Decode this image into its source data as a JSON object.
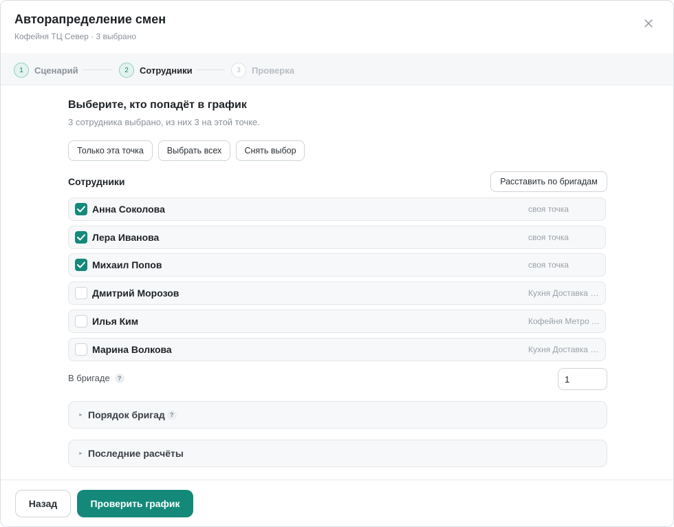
{
  "header": {
    "title": "Авторапределение смен",
    "subtitle": "Кофейня ТЦ Север · 3 выбрано",
    "close_icon": "close-icon"
  },
  "stepper": {
    "steps": [
      {
        "num": "1",
        "label": "Сценарий",
        "state": "done"
      },
      {
        "num": "2",
        "label": "Сотрудники",
        "state": "active"
      },
      {
        "num": "3",
        "label": "Проверка",
        "state": "todo"
      }
    ]
  },
  "selection": {
    "title": "Выберите, кто попадёт в график",
    "subtitle": "3 сотрудника выбрано, из них 3 на этой точке.",
    "only_this_point": "Только эта точка",
    "select_all": "Выбрать всех",
    "deselect": "Снять выбор"
  },
  "employees": {
    "label": "Сотрудники",
    "arrange_button": "Расставить по бригадам",
    "list": [
      {
        "name": "Анна Соколова",
        "location": "своя точка",
        "checked": true
      },
      {
        "name": "Лера Иванова",
        "location": "своя точка",
        "checked": true
      },
      {
        "name": "Михаил Попов",
        "location": "своя точка",
        "checked": true
      },
      {
        "name": "Дмитрий Морозов",
        "location": "Кухня Доставка Центр",
        "checked": false
      },
      {
        "name": "Илья Ким",
        "location": "Кофейня Метро Юг",
        "checked": false
      },
      {
        "name": "Марина Волкова",
        "location": "Кухня Доставка Центр",
        "checked": false
      }
    ]
  },
  "brigade": {
    "label": "В бригаде",
    "help": "?",
    "value": "1"
  },
  "accordions": {
    "order": {
      "title": "Порядок бригад",
      "help": "?"
    },
    "recent": {
      "title": "Последние расчёты"
    }
  },
  "footer": {
    "back": "Назад",
    "check": "Проверить график"
  },
  "colors": {
    "accent": "#14897a",
    "step_bg": "#e3f3ef"
  }
}
